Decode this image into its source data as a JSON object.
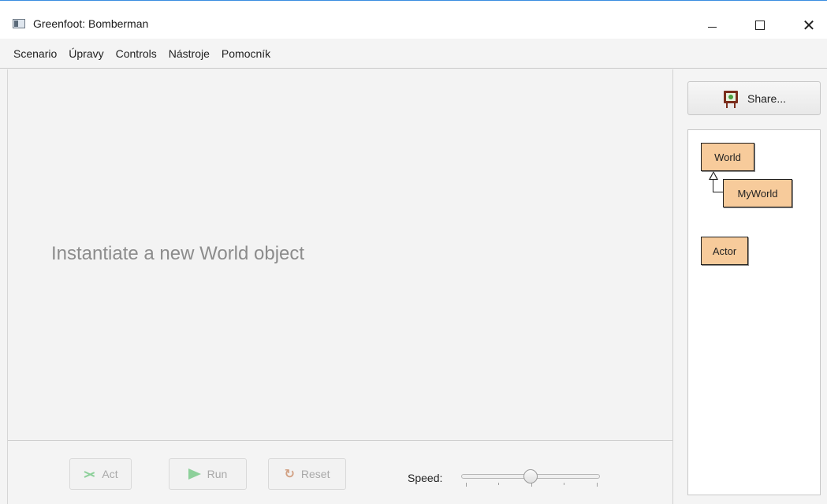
{
  "window": {
    "title": "Greenfoot: Bomberman",
    "minimize_label": "",
    "maximize_label": "",
    "close_label": "✕"
  },
  "menu": {
    "items": [
      "Scenario",
      "Úpravy",
      "Controls",
      "Nástroje",
      "Pomocník"
    ]
  },
  "world": {
    "message": "Instantiate a new World object"
  },
  "controls": {
    "act_label": "Act",
    "run_label": "Run",
    "reset_label": "Reset",
    "speed_label": "Speed:",
    "speed_level": 0.5,
    "reset_glyph": "↻"
  },
  "sidebar": {
    "share_label": "Share...",
    "classes": {
      "world": "World",
      "myworld": "MyWorld",
      "actor": "Actor"
    }
  },
  "colors": {
    "class_fill": "#f7cb9b",
    "disabled_icon_green": "#8dd09a",
    "title_accent": "#3a8de0"
  },
  "icons": {
    "app": "greenfoot-window-icon",
    "share": "easel-icon",
    "act": "act-chevron-icon",
    "run": "play-icon",
    "reset": "reset-icon"
  }
}
